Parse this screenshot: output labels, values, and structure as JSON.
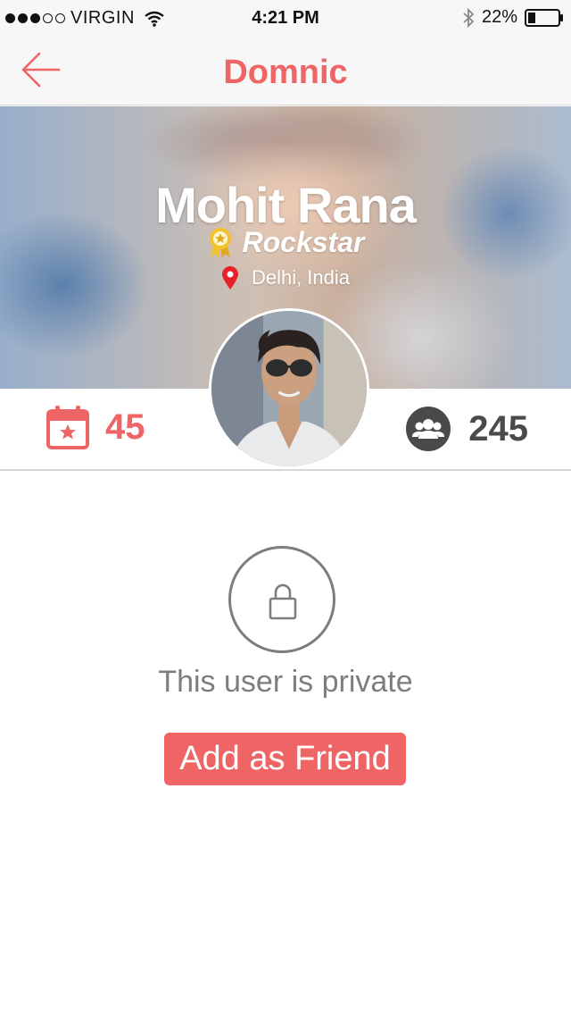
{
  "status_bar": {
    "carrier": "VIRGIN",
    "time": "4:21 PM",
    "battery": "22%",
    "signal_bars_filled": 3,
    "signal_bars_total": 5,
    "icons": [
      "wifi-icon",
      "bluetooth-icon",
      "battery-icon"
    ]
  },
  "nav": {
    "title": "Domnic",
    "back_icon": "back-arrow-icon"
  },
  "profile": {
    "name": "Mohit Rana",
    "title": "Rockstar",
    "location": "Delhi, India",
    "title_icon": "award-ribbon-icon",
    "location_icon": "map-pin-icon"
  },
  "stats": {
    "events_count": "45",
    "events_icon": "calendar-star-icon",
    "friends_count": "245",
    "friends_icon": "friends-group-icon"
  },
  "privacy": {
    "message": "This user is private",
    "lock_icon": "lock-icon",
    "add_friend_label": "Add as Friend"
  },
  "colors": {
    "accent": "#ef6464",
    "text_gray": "#7d7d7d",
    "stat_dark": "#4a4a4a",
    "award_gold": "#f2c12e",
    "pin_red": "#e8202a"
  }
}
